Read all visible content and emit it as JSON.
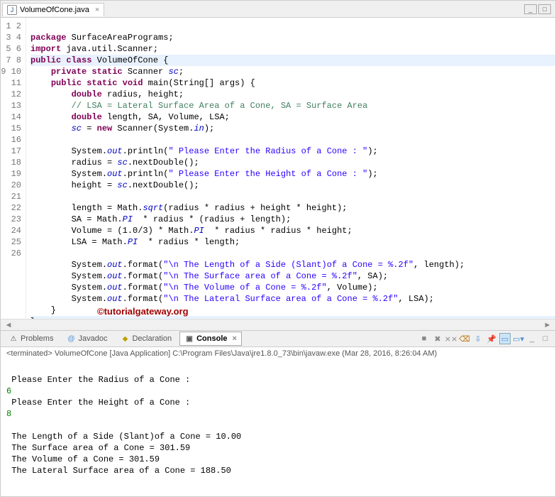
{
  "editorTab": {
    "filename": "VolumeOfCone.java",
    "close": "×"
  },
  "winControls": {
    "min": "_",
    "max": "□"
  },
  "gutterStart": 1,
  "gutterEnd": 26,
  "code": {
    "l1": {
      "kw1": "package",
      "t1": " SurfaceAreaPrograms;"
    },
    "l2": {
      "kw1": "import",
      "t1": " java.util.Scanner;"
    },
    "l3": {
      "kw1": "public class",
      "t1": " VolumeOfCone {"
    },
    "l4": {
      "kw1": "private static",
      "t1": " Scanner ",
      "fld": "sc",
      "t2": ";"
    },
    "l5": {
      "kw1": "public static void",
      "t1": " main(String[] args) {"
    },
    "l6": {
      "kw1": "double",
      "t1": " radius, height;"
    },
    "l7": {
      "com": "// LSA = Lateral Surface Area of a Cone, SA = Surface Area"
    },
    "l8": {
      "kw1": "double",
      "t1": " length, SA, Volume, LSA;"
    },
    "l9": {
      "fld1": "sc",
      "t1": " = ",
      "kw1": "new",
      "t2": " Scanner(System.",
      "fld2": "in",
      "t3": ");"
    },
    "l10": {
      "t": ""
    },
    "l11": {
      "t1": "System.",
      "fld1": "out",
      "t2": ".println(",
      "str": "\" Please Enter the Radius of a Cone : \"",
      "t3": ");"
    },
    "l12": {
      "t1": "radius = ",
      "fld1": "sc",
      "t2": ".nextDouble();"
    },
    "l13": {
      "t1": "System.",
      "fld1": "out",
      "t2": ".println(",
      "str": "\" Please Enter the Height of a Cone : \"",
      "t3": ");"
    },
    "l14": {
      "t1": "height = ",
      "fld1": "sc",
      "t2": ".nextDouble();"
    },
    "l15": {
      "t": ""
    },
    "l16": {
      "t1": "length = Math.",
      "fld1": "sqrt",
      "t2": "(radius * radius + height * height);"
    },
    "l17": {
      "t1": "SA = Math.",
      "fld1": "PI",
      "t2": "  * radius * (radius + length);"
    },
    "l18": {
      "t1": "Volume = (1.0/3) * Math.",
      "fld1": "PI",
      "t2": "  * radius * radius * height;"
    },
    "l19": {
      "t1": "LSA = Math.",
      "fld1": "PI",
      "t2": "  * radius * length;"
    },
    "l20": {
      "t": ""
    },
    "l21": {
      "t1": "System.",
      "fld1": "out",
      "t2": ".format(",
      "str": "\"\\n The Length of a Side (Slant)of a Cone = %.2f\"",
      "t3": ", length);"
    },
    "l22": {
      "t1": "System.",
      "fld1": "out",
      "t2": ".format(",
      "str": "\"\\n The Surface area of a Cone = %.2f\"",
      "t3": ", SA);"
    },
    "l23": {
      "t1": "System.",
      "fld1": "out",
      "t2": ".format(",
      "str": "\"\\n The Volume of a Cone = %.2f\"",
      "t3": ", Volume);"
    },
    "l24": {
      "t1": "System.",
      "fld1": "out",
      "t2": ".format(",
      "str": "\"\\n The Lateral Surface area of a Cone = %.2f\"",
      "t3": ", LSA);"
    },
    "l25": {
      "t": "    }"
    },
    "l26": {
      "t": "}"
    }
  },
  "watermark": "©tutorialgateway.org",
  "views": {
    "problems": "Problems",
    "javadoc": "Javadoc",
    "declaration": "Declaration",
    "console": "Console"
  },
  "consoleHeader": "<terminated> VolumeOfCone [Java Application] C:\\Program Files\\Java\\jre1.8.0_73\\bin\\javaw.exe (Mar 28, 2016, 8:26:04 AM)",
  "consoleOut": {
    "l1": " Please Enter the Radius of a Cone : ",
    "l2": "6",
    "l3": " Please Enter the Height of a Cone : ",
    "l4": "8",
    "l5": "",
    "l6": " The Length of a Side (Slant)of a Cone = 10.00",
    "l7": " The Surface area of a Cone = 301.59",
    "l8": " The Volume of a Cone = 301.59",
    "l9": " The Lateral Surface area of a Cone = 188.50"
  }
}
